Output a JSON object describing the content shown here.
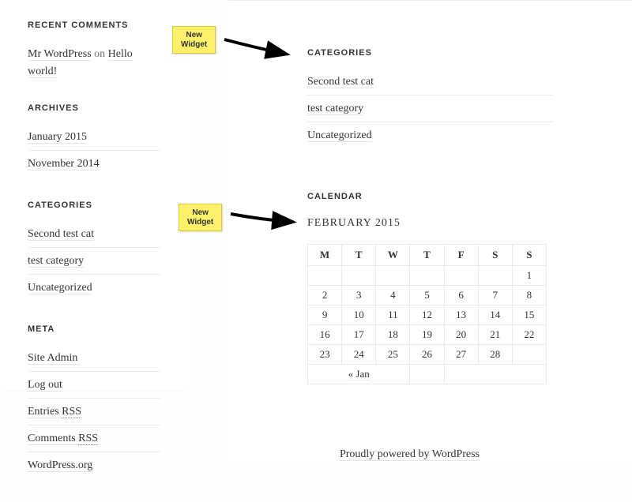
{
  "annotations": {
    "note1": "New\nWidget",
    "note2": "New\nWidget"
  },
  "sidebar": {
    "recentComments": {
      "title": "RECENT COMMENTS",
      "items": [
        {
          "author": "Mr WordPress",
          "on": "on",
          "post": "Hello world!"
        }
      ]
    },
    "archives": {
      "title": "ARCHIVES",
      "items": [
        "January 2015",
        "November 2014"
      ]
    },
    "categories": {
      "title": "CATEGORIES",
      "items": [
        "Second test cat",
        "test category",
        "Uncategorized"
      ]
    },
    "meta": {
      "title": "META",
      "items": [
        {
          "label": "Site Admin"
        },
        {
          "label": "Log out"
        },
        {
          "label": "Entries ",
          "abbr": "RSS"
        },
        {
          "label": "Comments ",
          "abbr": "RSS"
        },
        {
          "label": "WordPress.org"
        }
      ]
    }
  },
  "main": {
    "categories": {
      "title": "CATEGORIES",
      "items": [
        "Second test cat",
        "test category",
        "Uncategorized"
      ]
    },
    "calendar": {
      "title": "CALENDAR",
      "caption": "FEBRUARY 2015",
      "dow": [
        "M",
        "T",
        "W",
        "T",
        "F",
        "S",
        "S"
      ],
      "weeks": [
        [
          "",
          "",
          "",
          "",
          "",
          "",
          "1"
        ],
        [
          "2",
          "3",
          "4",
          "5",
          "6",
          "7",
          "8"
        ],
        [
          "9",
          "10",
          "11",
          "12",
          "13",
          "14",
          "15"
        ],
        [
          "16",
          "17",
          "18",
          "19",
          "20",
          "21",
          "22"
        ],
        [
          "23",
          "24",
          "25",
          "26",
          "27",
          "28",
          ""
        ]
      ],
      "prev": "« Jan",
      "next": ""
    }
  },
  "footer": {
    "credit": "Proudly powered by WordPress"
  }
}
